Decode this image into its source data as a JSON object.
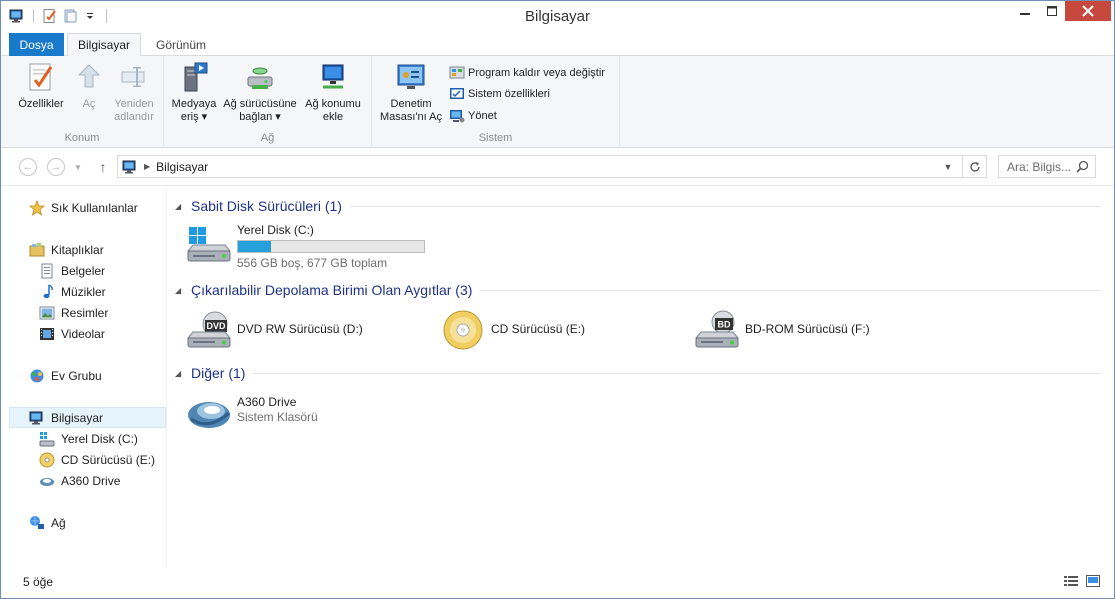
{
  "window": {
    "title": "Bilgisayar"
  },
  "ribbon": {
    "tabs": [
      {
        "label": "Dosya"
      },
      {
        "label": "Bilgisayar"
      },
      {
        "label": "Görünüm"
      }
    ],
    "groups": {
      "konum": {
        "label": "Konum",
        "buttons": [
          {
            "label": "Özellikler"
          },
          {
            "label": "Aç"
          },
          {
            "label_line1": "Yeniden",
            "label_line2": "adlandır"
          }
        ]
      },
      "ag": {
        "label": "Ağ",
        "buttons": [
          {
            "label_line1": "Medyaya",
            "label_line2": "eriş"
          },
          {
            "label_line1": "Ağ sürücüsüne",
            "label_line2": "bağlan"
          },
          {
            "label_line1": "Ağ konumu",
            "label_line2": "ekle"
          }
        ]
      },
      "sistem": {
        "label": "Sistem",
        "big_button": {
          "label_line1": "Denetim",
          "label_line2": "Masası'nı Aç"
        },
        "small_buttons": [
          {
            "label": "Program kaldır veya değiştir"
          },
          {
            "label": "Sistem özellikleri"
          },
          {
            "label": "Yönet"
          }
        ]
      }
    }
  },
  "address": {
    "breadcrumb": "Bilgisayar",
    "search_placeholder": "Ara: Bilgis..."
  },
  "nav_pane": {
    "favorites": "Sık Kullanılanlar",
    "libraries": {
      "label": "Kitaplıklar",
      "items": [
        "Belgeler",
        "Müzikler",
        "Resimler",
        "Videolar"
      ]
    },
    "homegroup": "Ev Grubu",
    "computer": {
      "label": "Bilgisayar",
      "items": [
        "Yerel Disk (C:)",
        "CD Sürücüsü (E:)",
        "A360 Drive"
      ]
    },
    "network": "Ağ"
  },
  "content": {
    "groups": [
      {
        "title": "Sabit Disk Sürücüleri (1)",
        "items": [
          {
            "name": "Yerel Disk (C:)",
            "detail": "556 GB boş, 677 GB toplam",
            "used_fraction": 0.18
          }
        ]
      },
      {
        "title": "Çıkarılabilir Depolama Birimi Olan Aygıtlar (3)",
        "items": [
          {
            "name": "DVD RW Sürücüsü (D:)",
            "badge": "DVD"
          },
          {
            "name": "CD Sürücüsü (E:)"
          },
          {
            "name": "BD-ROM Sürücüsü (F:)",
            "badge": "BD"
          }
        ]
      },
      {
        "title": "Diğer (1)",
        "items": [
          {
            "name": "A360 Drive",
            "detail": "Sistem Klasörü"
          }
        ]
      }
    ]
  },
  "status": {
    "item_count": "5 öğe"
  },
  "colors": {
    "accent": "#1979ca",
    "close": "#c7483c",
    "group_title": "#1e3287",
    "progress": "#26a0da"
  }
}
